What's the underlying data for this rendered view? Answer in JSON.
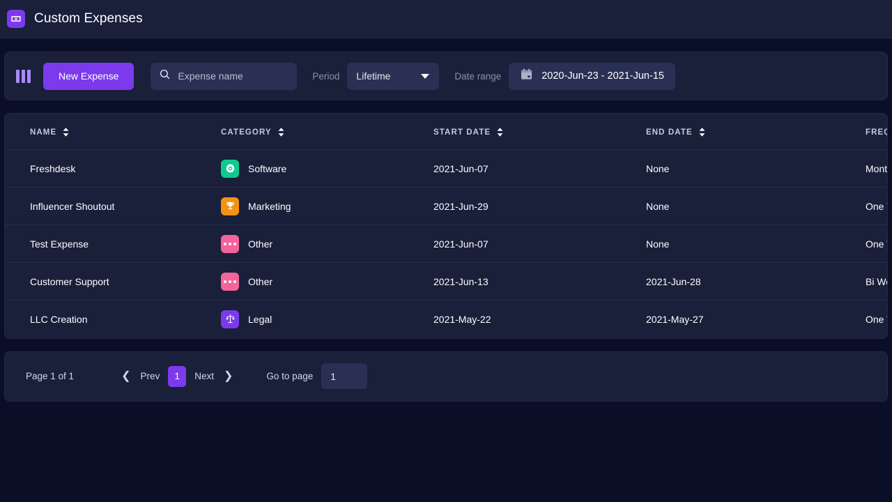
{
  "header": {
    "title": "Custom Expenses",
    "logo_icon": "banknote-icon"
  },
  "toolbar": {
    "columns_icon": "columns-icon",
    "new_expense_label": "New Expense",
    "search": {
      "icon": "search-icon",
      "placeholder": "Expense name",
      "value": ""
    },
    "period": {
      "label": "Period",
      "selected": "Lifetime",
      "caret_icon": "chevron-down-icon"
    },
    "date_range": {
      "label": "Date range",
      "icon": "calendar-icon",
      "value": "2020-Jun-23  -  2021-Jun-15"
    }
  },
  "table": {
    "columns": [
      {
        "key": "name",
        "label": "NAME",
        "sortable": true
      },
      {
        "key": "category",
        "label": "CATEGORY",
        "sortable": true
      },
      {
        "key": "start_date",
        "label": "START DATE",
        "sortable": true
      },
      {
        "key": "end_date",
        "label": "END DATE",
        "sortable": true
      },
      {
        "key": "frequency",
        "label": "FREQUENCY",
        "sortable": true
      }
    ],
    "rows": [
      {
        "name": "Freshdesk",
        "category": "Software",
        "category_icon": "gear-icon",
        "category_color": "#10c98f",
        "start_date": "2021-Jun-07",
        "end_date": "None",
        "frequency": "Monthly"
      },
      {
        "name": "Influencer Shoutout",
        "category": "Marketing",
        "category_icon": "trophy-icon",
        "category_color": "#f59211",
        "start_date": "2021-Jun-29",
        "end_date": "None",
        "frequency": "One Time"
      },
      {
        "name": "Test Expense",
        "category": "Other",
        "category_icon": "ellipsis-icon",
        "category_color": "#f4649b",
        "start_date": "2021-Jun-07",
        "end_date": "None",
        "frequency": "One Time"
      },
      {
        "name": "Customer Support",
        "category": "Other",
        "category_icon": "ellipsis-icon",
        "category_color": "#f4649b",
        "start_date": "2021-Jun-13",
        "end_date": "2021-Jun-28",
        "frequency": "Bi Weekly"
      },
      {
        "name": "LLC Creation",
        "category": "Legal",
        "category_icon": "scales-icon",
        "category_color": "#7c3aed",
        "start_date": "2021-May-22",
        "end_date": "2021-May-27",
        "frequency": "One Time"
      }
    ]
  },
  "pagination": {
    "page_status": "Page 1 of 1",
    "prev_label": "Prev",
    "next_label": "Next",
    "current_page": "1",
    "goto_label": "Go to page",
    "goto_value": "1"
  },
  "colors": {
    "page_bg": "#0a0e27",
    "card_bg": "#1a1f3a",
    "accent": "#7c3aed",
    "input_bg": "#2a3054"
  }
}
